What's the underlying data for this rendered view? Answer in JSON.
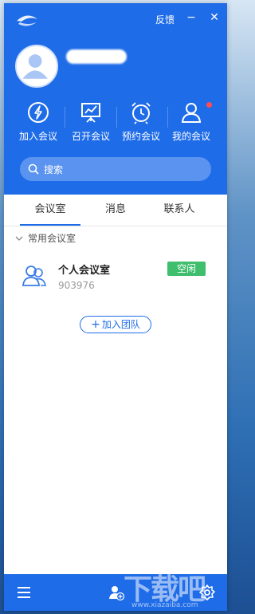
{
  "window": {
    "feedback_label": "反馈",
    "minimize_glyph": "−",
    "close_glyph": "✕",
    "accent_color": "#1f6ce8"
  },
  "user": {
    "avatar_icon": "user-avatar-icon"
  },
  "actions": [
    {
      "label": "加入会议",
      "icon": "join-meeting-icon"
    },
    {
      "label": "召开会议",
      "icon": "start-meeting-icon"
    },
    {
      "label": "预约会议",
      "icon": "alarm-clock-icon"
    },
    {
      "label": "我的会议",
      "icon": "person-icon",
      "has_badge": true
    }
  ],
  "search": {
    "placeholder": "搜索",
    "icon": "search-icon"
  },
  "tabs": [
    {
      "label": "会议室",
      "active": true
    },
    {
      "label": "消息",
      "active": false
    },
    {
      "label": "联系人",
      "active": false
    }
  ],
  "group": {
    "label": "常用会议室",
    "expanded": true
  },
  "rooms": [
    {
      "name": "个人会议室",
      "id": "903976",
      "status": "空闲",
      "status_color": "#3fbf6e"
    }
  ],
  "join_team": {
    "label": "加入团队",
    "plus": "+"
  },
  "footer": {
    "menu_icon": "menu-icon",
    "add_contact_icon": "add-user-icon",
    "settings_icon": "gear-icon"
  },
  "watermark": {
    "text": "下载吧",
    "sub": "www.xiazaiba.com"
  }
}
